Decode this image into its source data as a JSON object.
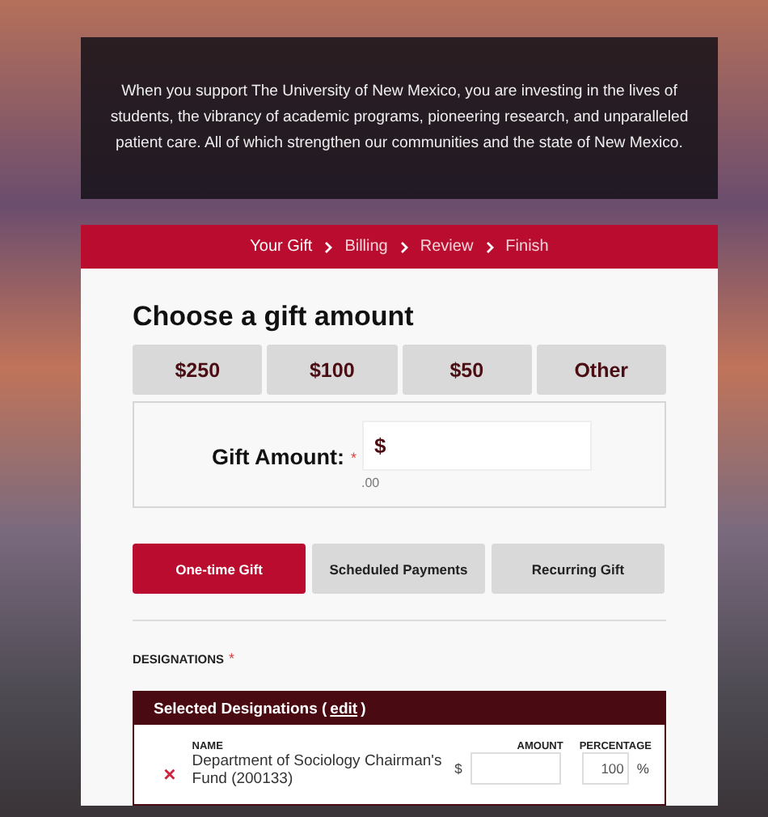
{
  "intro": {
    "text": "When you support The University of New Mexico, you are investing in the lives of students, the vibrancy of academic programs, pioneering research, and unparalleled patient care. All of which strengthen our communities and the state of New Mexico."
  },
  "steps": [
    {
      "label": "Your Gift",
      "selected": true
    },
    {
      "label": "Billing",
      "selected": false
    },
    {
      "label": "Review",
      "selected": false
    },
    {
      "label": "Finish",
      "selected": false
    }
  ],
  "heading": "Choose a gift amount",
  "amount_options": [
    {
      "label": "$250",
      "selected": false
    },
    {
      "label": "$100",
      "selected": false
    },
    {
      "label": "$50",
      "selected": false
    },
    {
      "label": "Other",
      "selected": false
    }
  ],
  "gift_amount": {
    "label": "Gift Amount:",
    "required_mark": "*",
    "prefix": "$",
    "suffix": ".00"
  },
  "frequency": [
    {
      "label": "One-time Gift",
      "selected": true
    },
    {
      "label": "Scheduled Payments",
      "selected": false
    },
    {
      "label": "Recurring Gift",
      "selected": false
    }
  ],
  "designations": {
    "label": "DESIGNATIONS",
    "required_mark": "*",
    "panel_title": "Selected Designations (",
    "edit_link": "edit",
    "panel_title_end": ")",
    "columns": [
      "NAME",
      "AMOUNT",
      "PERCENTAGE"
    ],
    "rows": [
      {
        "remove": "×",
        "name": "Department of Sociology Chairman's Fund (200133)",
        "currency": "$",
        "percentage": "100",
        "percent_sign": "%"
      }
    ]
  }
}
